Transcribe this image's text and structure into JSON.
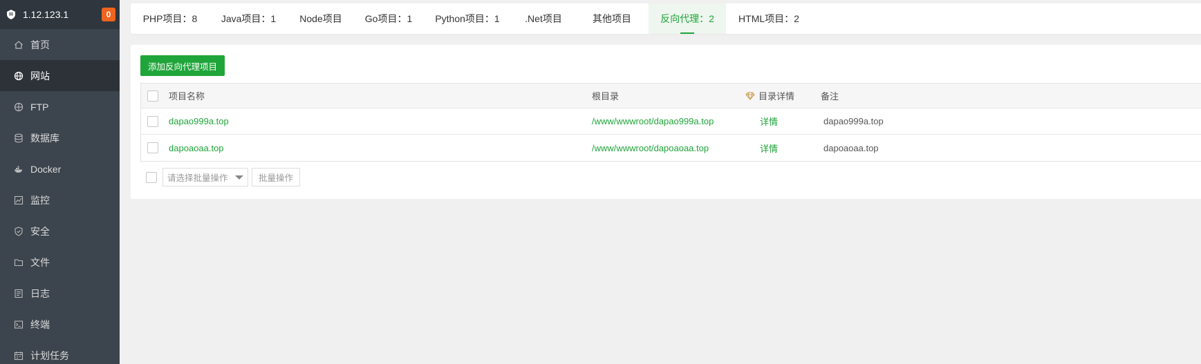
{
  "sidebar": {
    "ip": "1.12.123.1",
    "badge": "0",
    "items": [
      {
        "label": "首页",
        "icon": "home-icon"
      },
      {
        "label": "网站",
        "icon": "globe-icon",
        "active": true
      },
      {
        "label": "FTP",
        "icon": "ftp-icon"
      },
      {
        "label": "数据库",
        "icon": "database-icon"
      },
      {
        "label": "Docker",
        "icon": "docker-icon"
      },
      {
        "label": "监控",
        "icon": "monitor-icon"
      },
      {
        "label": "安全",
        "icon": "shield-icon"
      },
      {
        "label": "文件",
        "icon": "folder-icon"
      },
      {
        "label": "日志",
        "icon": "log-icon"
      },
      {
        "label": "终端",
        "icon": "terminal-icon"
      },
      {
        "label": "计划任务",
        "icon": "calendar-icon"
      }
    ]
  },
  "tabs": [
    {
      "label": "PHP项目：8"
    },
    {
      "label": "Java项目：1"
    },
    {
      "label": "Node项目"
    },
    {
      "label": "Go项目：1"
    },
    {
      "label": "Python项目：1"
    },
    {
      "label": ".Net项目"
    },
    {
      "label": "其他项目"
    },
    {
      "label": "反向代理：2",
      "active": true
    },
    {
      "label": "HTML项目：2"
    }
  ],
  "main": {
    "add_button": "添加反向代理项目",
    "table": {
      "headers": {
        "name": "项目名称",
        "root": "根目录",
        "detail": "目录详情",
        "note": "备注"
      },
      "rows": [
        {
          "name": "dapao999a.top",
          "root": "/www/wwwroot/dapao999a.top",
          "detail": "详情",
          "note": "dapao999a.top"
        },
        {
          "name": "dapoaoaa.top",
          "root": "/www/wwwroot/dapoaoaa.top",
          "detail": "详情",
          "note": "dapoaoaa.top"
        }
      ]
    },
    "batch": {
      "select_placeholder": "请选择批量操作",
      "button": "批量操作"
    }
  },
  "colors": {
    "accent": "#20a53a",
    "sidebar_bg": "#3c444d",
    "badge": "#f0641e",
    "gem": "#c89b4a"
  }
}
